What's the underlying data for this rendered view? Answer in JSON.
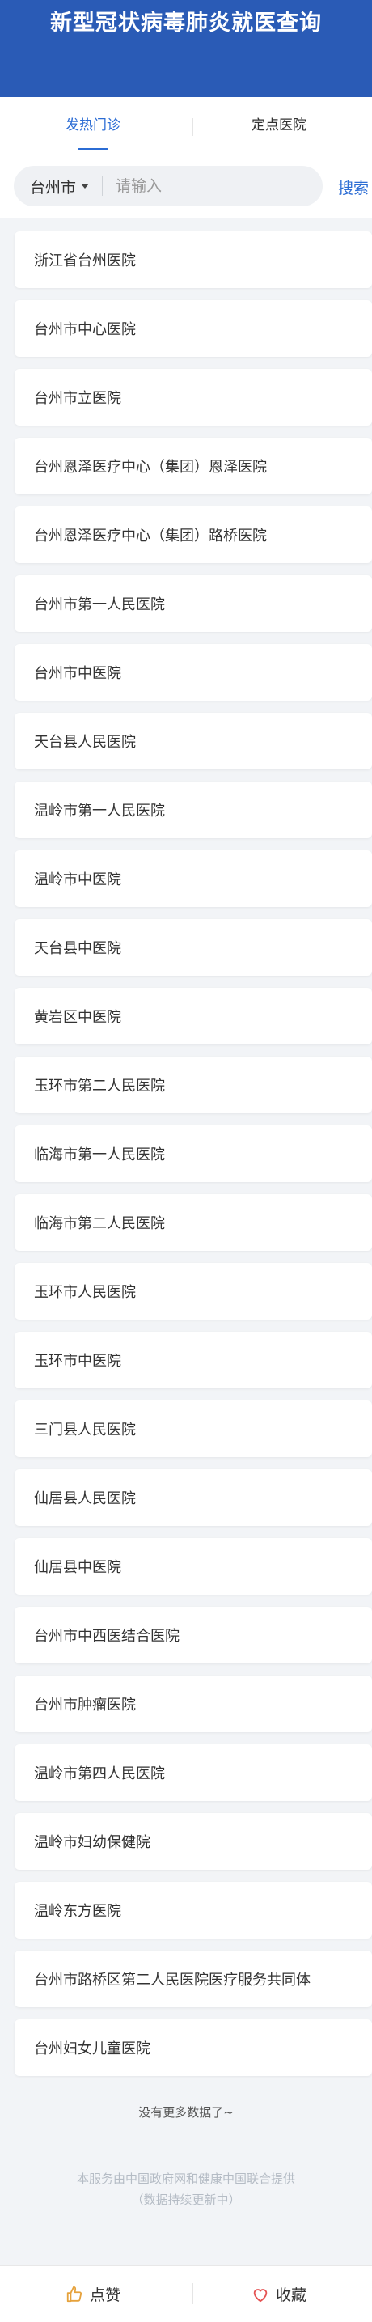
{
  "header": {
    "title": "新型冠状病毒肺炎就医查询"
  },
  "tabs": [
    {
      "label": "发热门诊",
      "active": true
    },
    {
      "label": "定点医院",
      "active": false
    }
  ],
  "search": {
    "city": "台州市",
    "placeholder": "请输入",
    "value": "",
    "button_label": "搜索"
  },
  "hospitals": [
    "浙江省台州医院",
    "台州市中心医院",
    "台州市立医院",
    "台州恩泽医疗中心（集团）恩泽医院",
    "台州恩泽医疗中心（集团）路桥医院",
    "台州市第一人民医院",
    "台州市中医院",
    "天台县人民医院",
    "温岭市第一人民医院",
    "温岭市中医院",
    "天台县中医院",
    "黄岩区中医院",
    "玉环市第二人民医院",
    "临海市第一人民医院",
    "临海市第二人民医院",
    "玉环市人民医院",
    "玉环市中医院",
    "三门县人民医院",
    "仙居县人民医院",
    "仙居县中医院",
    "台州市中西医结合医院",
    "台州市肿瘤医院",
    "温岭市第四人民医院",
    "温岭市妇幼保健院",
    "温岭东方医院",
    "台州市路桥区第二人民医院医疗服务共同体",
    "台州妇女儿童医院"
  ],
  "no_more": "没有更多数据了~",
  "footer": {
    "line1": "本服务由中国政府网和健康中国联合提供",
    "line2": "（数据持续更新中）"
  },
  "bottom": {
    "like_label": "点赞",
    "collect_label": "收藏",
    "like_icon": "thumbs-up-icon",
    "collect_icon": "heart-icon"
  },
  "colors": {
    "header_bg": "#2a5bb6",
    "accent": "#2b6cd4",
    "like": "#e6a23c",
    "heart": "#e55353"
  }
}
